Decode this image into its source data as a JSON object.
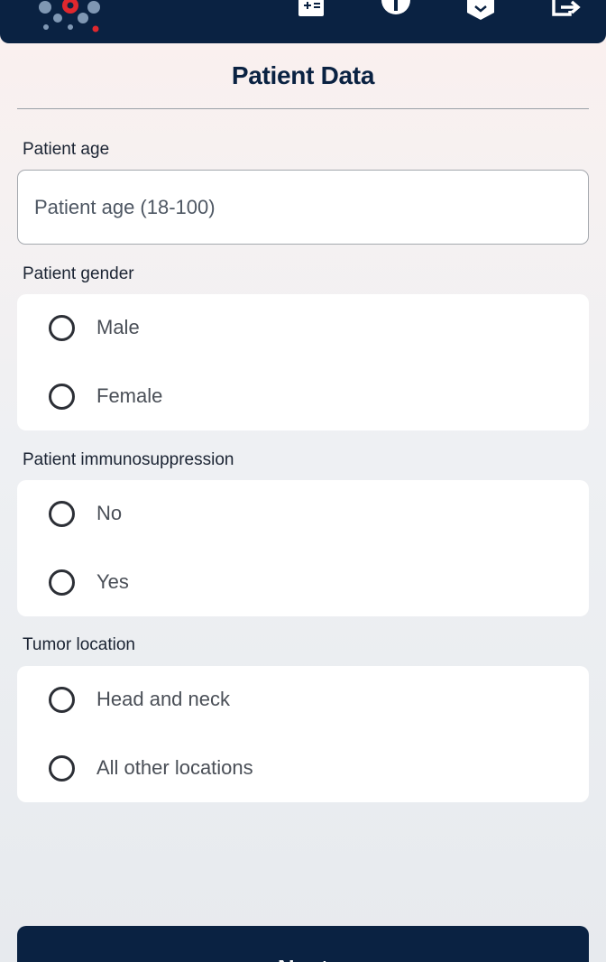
{
  "header": {
    "icons": [
      "calculator-icon",
      "info-icon",
      "bookmark-icon",
      "logout-icon"
    ],
    "colors": {
      "bar": "#0a2242",
      "logo_accent": "#e0282e",
      "logo_dots": "#7f97b3"
    }
  },
  "page": {
    "title": "Patient Data"
  },
  "age": {
    "label": "Patient age",
    "placeholder": "Patient age (18-100)",
    "value": ""
  },
  "gender": {
    "label": "Patient gender",
    "options": [
      "Male",
      "Female"
    ]
  },
  "immunosuppression": {
    "label": "Patient immunosuppression",
    "options": [
      "No",
      "Yes"
    ]
  },
  "tumor_location": {
    "label": "Tumor location",
    "options": [
      "Head and neck",
      "All other locations"
    ]
  },
  "footer": {
    "next_label": "Next"
  }
}
